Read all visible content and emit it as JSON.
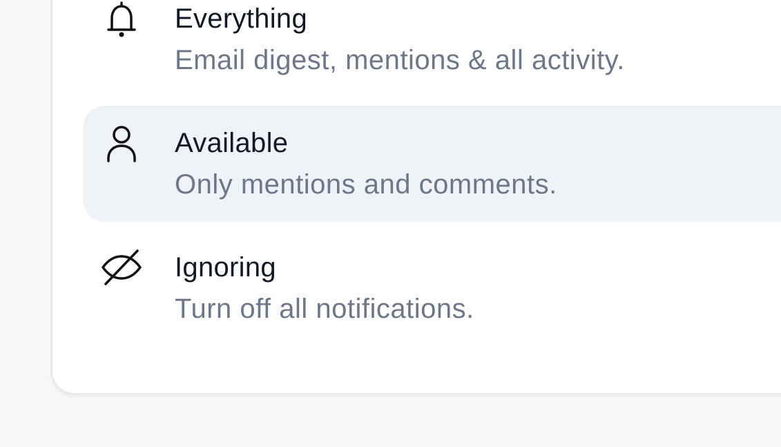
{
  "notification_options": [
    {
      "icon": "bell-icon",
      "title": "Everything",
      "description": "Email digest, mentions & all activity.",
      "selected": false
    },
    {
      "icon": "user-icon",
      "title": "Available",
      "description": "Only mentions and comments.",
      "selected": true
    },
    {
      "icon": "eye-off-icon",
      "title": "Ignoring",
      "description": "Turn off all notifications.",
      "selected": false
    }
  ],
  "colors": {
    "page_background": "#f8f7f6",
    "card_background": "#ffffff",
    "selected_background": "#eff2f7",
    "title_text": "#111827",
    "description_text": "#6b778a"
  }
}
